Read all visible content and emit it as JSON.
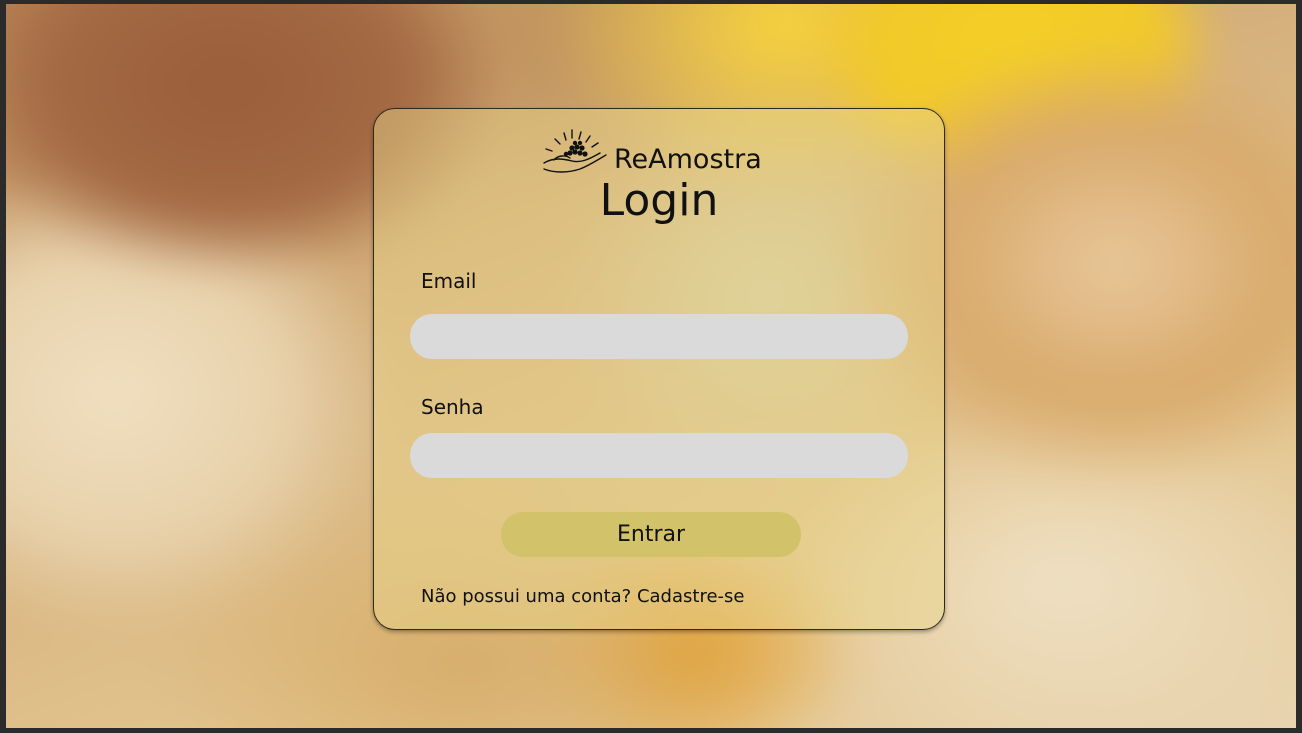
{
  "brand": {
    "name": "ReAmostra",
    "logo_icon": "hand-holding-seeds-icon"
  },
  "login": {
    "title": "Login",
    "email_label": "Email",
    "email_value": "",
    "password_label": "Senha",
    "password_value": "",
    "submit_label": "Entrar",
    "signup_prompt": "Não possui uma conta?",
    "signup_link": "Cadastre-se"
  },
  "colors": {
    "card_bg": "#e8d68c",
    "input_bg": "#dadada",
    "button_bg": "#d2c36a",
    "text": "#111111"
  }
}
